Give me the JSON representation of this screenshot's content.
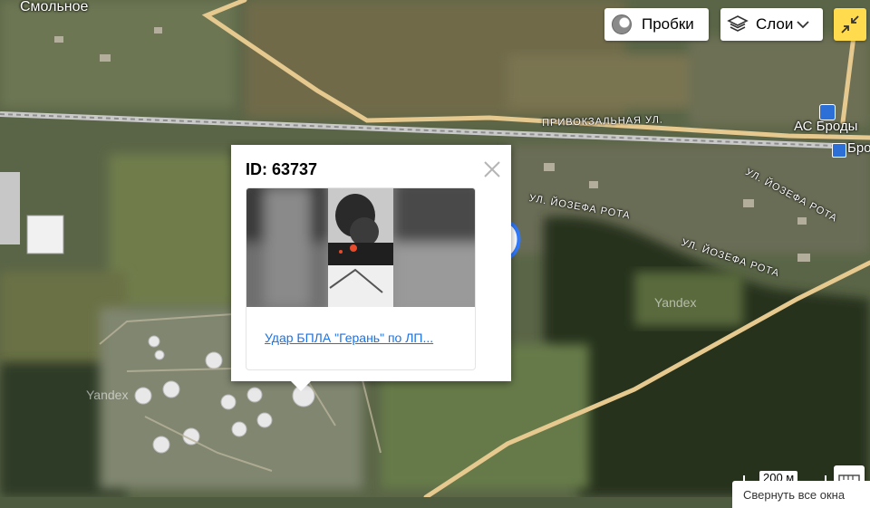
{
  "map": {
    "place_labels": [
      "Смольное",
      "АС Броды",
      "Бро"
    ],
    "street_labels": [
      "ПРИВОКЗАЛЬНАЯ УЛ.",
      "УЛ. ЙОЗЕФА РОТА",
      "УЛ. ЙОЗЕФА РОТА",
      "УЛ. ЙОЗЕФА РОТА"
    ],
    "watermarks": [
      "Yandex",
      "Yandex"
    ]
  },
  "controls": {
    "traffic_label": "Пробки",
    "layers_label": "Слои",
    "fullscreen_icon": "collapse-arrows-icon"
  },
  "popup": {
    "title": "ID: 63737",
    "link_text": "Удар БПЛА \"Герань\" по ЛП..."
  },
  "scale": {
    "label": "200 м"
  },
  "footer": {
    "collapse_text": "Свернуть все окна"
  }
}
